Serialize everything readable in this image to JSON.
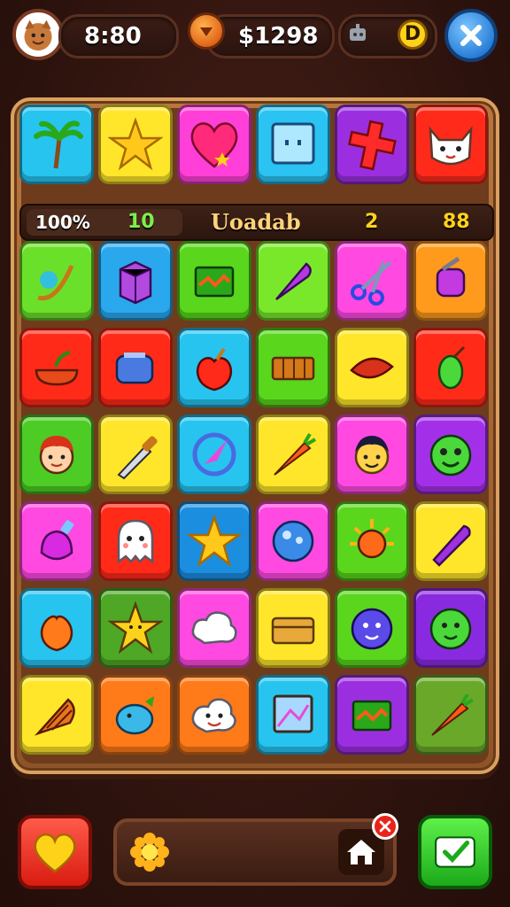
{
  "hud": {
    "timer": "8:80",
    "coins": "$1298",
    "avatar_icon": "player-avatar-icon",
    "coin_icon": "coin-icon",
    "robot_icon": "robot-icon",
    "badge_letter": "D",
    "close_icon": "close-icon"
  },
  "status": {
    "percent": "100%",
    "value_green": "10",
    "mode_label": "Uoadab",
    "value_yellow": "2",
    "value_right": "88"
  },
  "grid": {
    "rows": 7,
    "cols": 6,
    "tiles": [
      [
        "palm-tree-icon",
        "star-icon",
        "heart-icon",
        "screen-icon",
        "cross-icon",
        "cat-face-icon"
      ],
      [
        "wand-icon",
        "cube-icon",
        "box-icon",
        "feather-icon",
        "scissors-icon",
        "lantern-icon"
      ],
      [
        "bowl-icon",
        "toaster-icon",
        "apple-icon",
        "crate-icon",
        "leaf-icon",
        "vase-icon"
      ],
      [
        "boy-face-icon",
        "knife-icon",
        "compass-icon",
        "carrot-icon",
        "smiley-man-icon",
        "monster-icon"
      ],
      [
        "potion-icon",
        "ghost-icon",
        "star-icon",
        "bubble-icon",
        "sun-icon",
        "pen-icon"
      ],
      [
        "peach-icon",
        "starfish-icon",
        "cloud-icon",
        "chest-icon",
        "blob-icon",
        "slime-icon"
      ],
      [
        "shell-icon",
        "bird-icon",
        "smile-cloud-icon",
        "picture-icon",
        "box-icon",
        "carrot-icon"
      ]
    ],
    "colors": [
      [
        "#27c4f0",
        "#ffe62a",
        "#ff3fd8",
        "#2bc3f2",
        "#9b2fe0",
        "#ff2a1a"
      ],
      [
        "#6be02a",
        "#2aa8ee",
        "#5ad61c",
        "#7ae82a",
        "#ff49e0",
        "#ff9a1c"
      ],
      [
        "#ff2a18",
        "#ff2a18",
        "#27c4f0",
        "#5ad61c",
        "#ffe62a",
        "#ff2a18"
      ],
      [
        "#4ccc24",
        "#ffe62a",
        "#27c4f0",
        "#ffe62a",
        "#ff49e0",
        "#a330e8"
      ],
      [
        "#ff49e0",
        "#ff2a18",
        "#1c8ee0",
        "#ff49e0",
        "#5ad61c",
        "#ffe62a"
      ],
      [
        "#27c4f0",
        "#4ea826",
        "#ff49e0",
        "#ffe62a",
        "#5ad61c",
        "#8a2ae0"
      ],
      [
        "#ffe62a",
        "#ff7a18",
        "#ff7a18",
        "#27c4f0",
        "#9b2fe0",
        "#6aa82a"
      ]
    ]
  },
  "bottom": {
    "heart_icon": "heart-icon",
    "flower_icon": "flower-icon",
    "home_icon": "home-icon",
    "close_badge_icon": "close-icon",
    "confirm_icon": "confirm-icon"
  }
}
